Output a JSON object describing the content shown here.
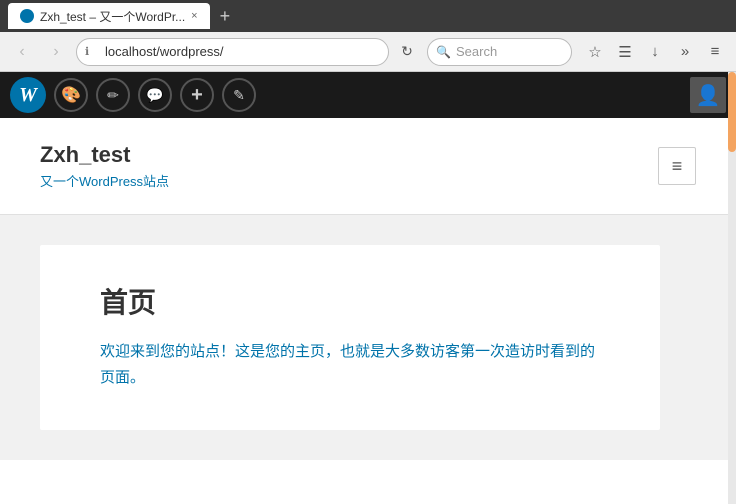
{
  "browser": {
    "tab": {
      "title": "Zxh_test – 又一个WordPr...",
      "close": "×"
    },
    "tab_new": "+",
    "navbar": {
      "back": "‹",
      "forward": "›",
      "address": "localhost/wordpress/",
      "reload": "↻",
      "search_placeholder": "Search",
      "bookmark_icon": "☆",
      "reader_icon": "☰",
      "download_icon": "↓",
      "more_icon": "»",
      "menu_icon": "≡"
    }
  },
  "adminbar": {
    "logo": "W",
    "icons": {
      "customize": "🎨",
      "paint": "✏",
      "comment": "💬",
      "add": "+",
      "edit": "✎"
    },
    "avatar_icon": "👤"
  },
  "site": {
    "title": "Zxh_test",
    "tagline": "又一个WordPress站点",
    "menu_icon": "≡"
  },
  "post": {
    "title": "首页",
    "body_line1": "欢迎来到您的站点！这是您的主页，也就是大多数访客第一次造访时看到的",
    "body_line2": "页面。"
  }
}
